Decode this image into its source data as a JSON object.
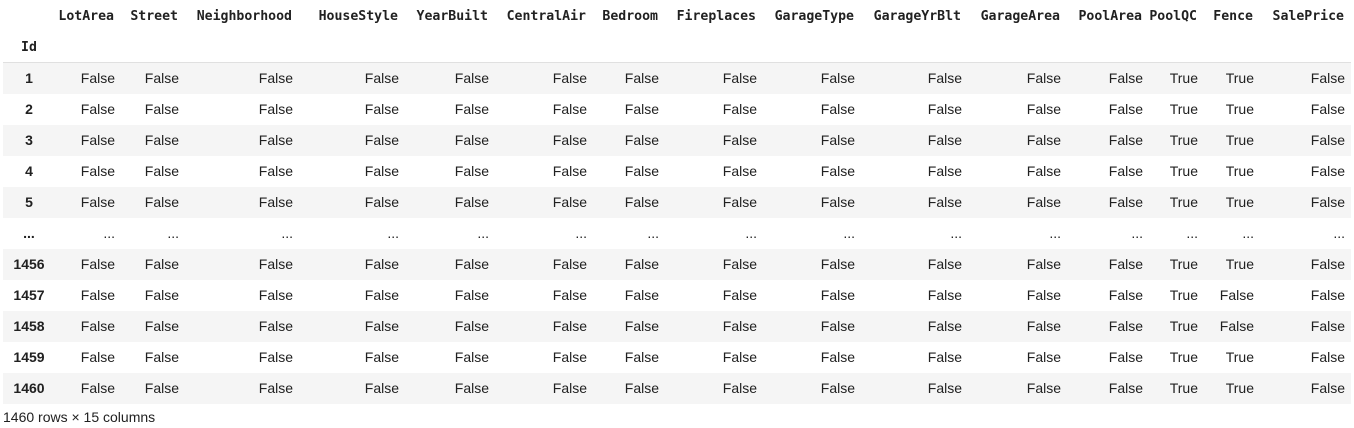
{
  "dataframe": {
    "columns": [
      "LotArea",
      "Street",
      "Neighborhood",
      "HouseStyle",
      "YearBuilt",
      "CentralAir",
      "Bedroom",
      "Fireplaces",
      "GarageType",
      "GarageYrBlt",
      "GarageArea",
      "PoolArea",
      "PoolQC",
      "Fence",
      "SalePrice"
    ],
    "index_name": "Id",
    "rows": [
      {
        "id": "1",
        "cells": [
          "False",
          "False",
          "False",
          "False",
          "False",
          "False",
          "False",
          "False",
          "False",
          "False",
          "False",
          "False",
          "True",
          "True",
          "False"
        ]
      },
      {
        "id": "2",
        "cells": [
          "False",
          "False",
          "False",
          "False",
          "False",
          "False",
          "False",
          "False",
          "False",
          "False",
          "False",
          "False",
          "True",
          "True",
          "False"
        ]
      },
      {
        "id": "3",
        "cells": [
          "False",
          "False",
          "False",
          "False",
          "False",
          "False",
          "False",
          "False",
          "False",
          "False",
          "False",
          "False",
          "True",
          "True",
          "False"
        ]
      },
      {
        "id": "4",
        "cells": [
          "False",
          "False",
          "False",
          "False",
          "False",
          "False",
          "False",
          "False",
          "False",
          "False",
          "False",
          "False",
          "True",
          "True",
          "False"
        ]
      },
      {
        "id": "5",
        "cells": [
          "False",
          "False",
          "False",
          "False",
          "False",
          "False",
          "False",
          "False",
          "False",
          "False",
          "False",
          "False",
          "True",
          "True",
          "False"
        ]
      },
      {
        "id": "...",
        "cells": [
          "...",
          "...",
          "...",
          "...",
          "...",
          "...",
          "...",
          "...",
          "...",
          "...",
          "...",
          "...",
          "...",
          "...",
          "..."
        ]
      },
      {
        "id": "1456",
        "cells": [
          "False",
          "False",
          "False",
          "False",
          "False",
          "False",
          "False",
          "False",
          "False",
          "False",
          "False",
          "False",
          "True",
          "True",
          "False"
        ]
      },
      {
        "id": "1457",
        "cells": [
          "False",
          "False",
          "False",
          "False",
          "False",
          "False",
          "False",
          "False",
          "False",
          "False",
          "False",
          "False",
          "True",
          "False",
          "False"
        ]
      },
      {
        "id": "1458",
        "cells": [
          "False",
          "False",
          "False",
          "False",
          "False",
          "False",
          "False",
          "False",
          "False",
          "False",
          "False",
          "False",
          "True",
          "False",
          "False"
        ]
      },
      {
        "id": "1459",
        "cells": [
          "False",
          "False",
          "False",
          "False",
          "False",
          "False",
          "False",
          "False",
          "False",
          "False",
          "False",
          "False",
          "True",
          "True",
          "False"
        ]
      },
      {
        "id": "1460",
        "cells": [
          "False",
          "False",
          "False",
          "False",
          "False",
          "False",
          "False",
          "False",
          "False",
          "False",
          "False",
          "False",
          "True",
          "True",
          "False"
        ]
      }
    ],
    "shape_text": "1460 rows × 15 columns"
  }
}
